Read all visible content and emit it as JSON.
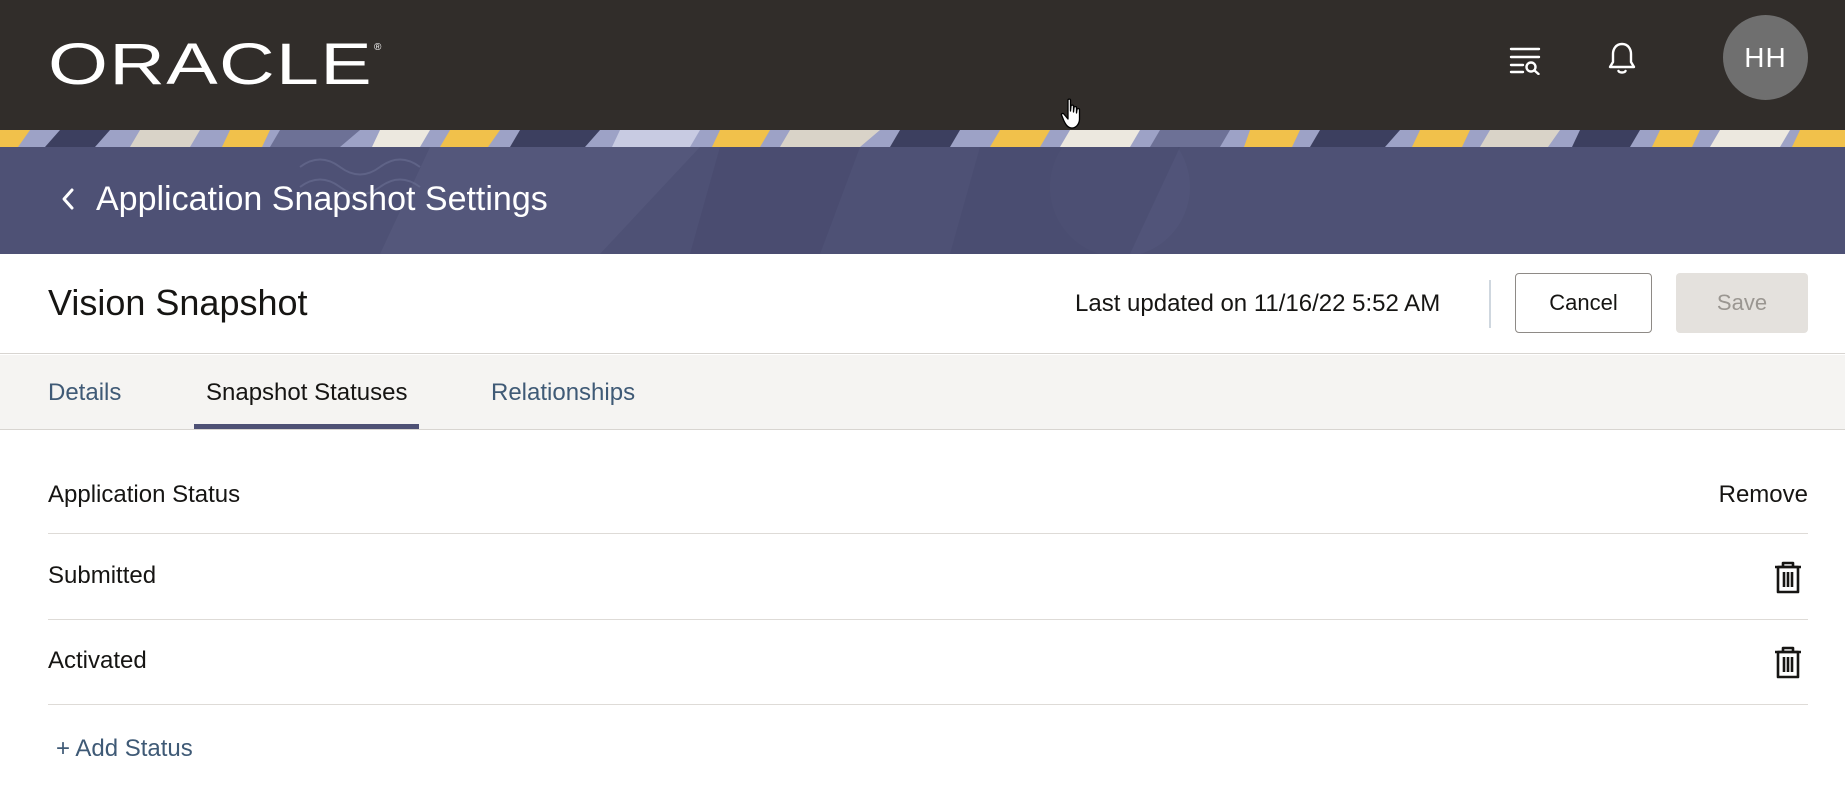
{
  "header": {
    "brand": "ORACLE",
    "avatar_initials": "HH",
    "icons": [
      "search-list-icon",
      "bell-icon"
    ]
  },
  "banner": {
    "title": "Application Snapshot Settings"
  },
  "record": {
    "title": "Vision Snapshot",
    "last_updated": "Last updated on 11/16/22 5:52 AM",
    "cancel_label": "Cancel",
    "save_label": "Save"
  },
  "tabs": [
    {
      "label": "Details",
      "active": false
    },
    {
      "label": "Snapshot Statuses",
      "active": true
    },
    {
      "label": "Relationships",
      "active": false
    }
  ],
  "statuses": {
    "column_label": "Application Status",
    "remove_label": "Remove",
    "rows": [
      {
        "label": "Submitted"
      },
      {
        "label": "Activated"
      }
    ],
    "add_label": "+ Add Status"
  },
  "colors": {
    "header_bg": "#312d2a",
    "banner_bg": "#4e5175",
    "link": "#3f5a76",
    "accent_underline": "#4e5175"
  }
}
